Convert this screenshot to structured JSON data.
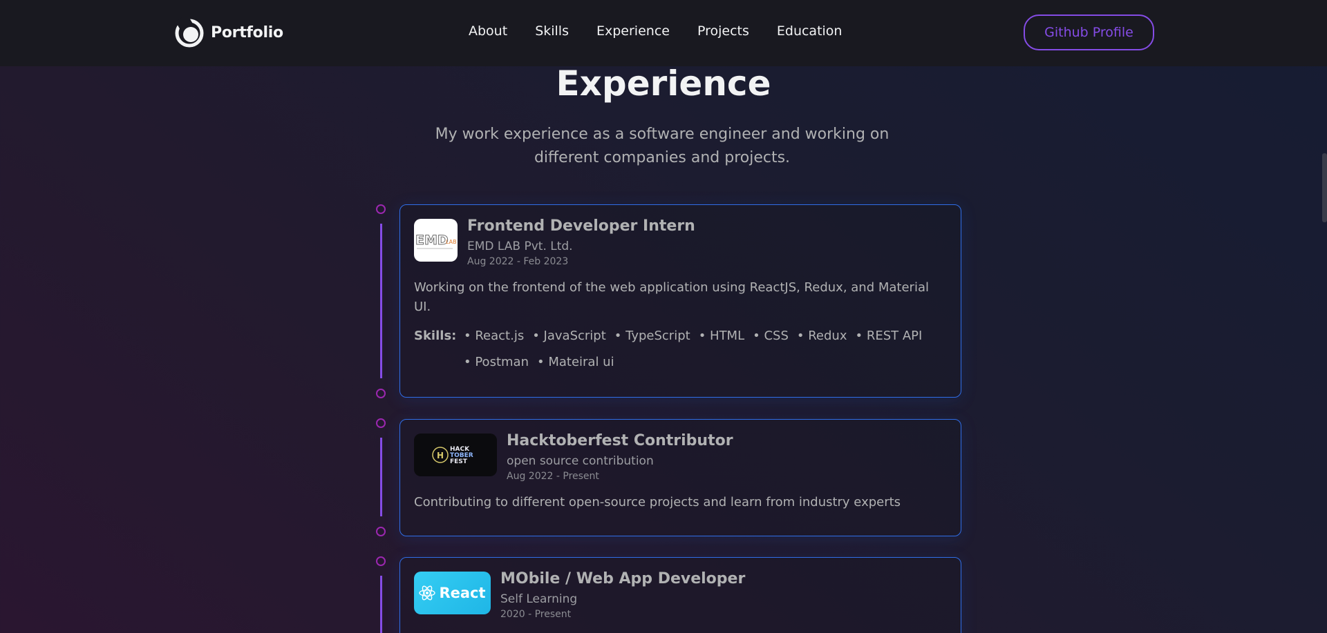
{
  "navbar": {
    "brand": "Portfolio",
    "links": [
      "About",
      "Skills",
      "Experience",
      "Projects",
      "Education"
    ],
    "github_label": "Github Profile"
  },
  "section": {
    "title": "Experience",
    "description": "My work experience as a software engineer and working on different companies and projects."
  },
  "experiences": [
    {
      "role": "Frontend Developer Intern",
      "company": "EMD LAB Pvt. Ltd.",
      "date": "Aug 2022 - Feb 2023",
      "description": "Working on the frontend of the web application using ReactJS, Redux, and Material UI.",
      "skills_label": "Skills:",
      "skills": [
        "React.js",
        "JavaScript",
        "TypeScript",
        "HTML",
        "CSS",
        "Redux",
        "REST API",
        "Postman",
        "Mateiral ui"
      ],
      "logo_text": "EMD",
      "logo_sub": "LAB"
    },
    {
      "role": "Hacktoberfest Contributor",
      "company": "open source contribution",
      "date": "Aug 2022 - Present",
      "description": "Contributing to different open-source projects and learn from industry experts",
      "logo_lines": [
        "HACK",
        "TOBER",
        "FEST"
      ]
    },
    {
      "role": "MObile / Web App Developer",
      "company": "Self Learning",
      "date": "2020 - Present",
      "logo_text": "React"
    }
  ],
  "colors": {
    "accent": "#854ce6",
    "timeline_dot": "#9c27b0",
    "card_border": "#306ee8",
    "nav_bg": "#191920"
  }
}
